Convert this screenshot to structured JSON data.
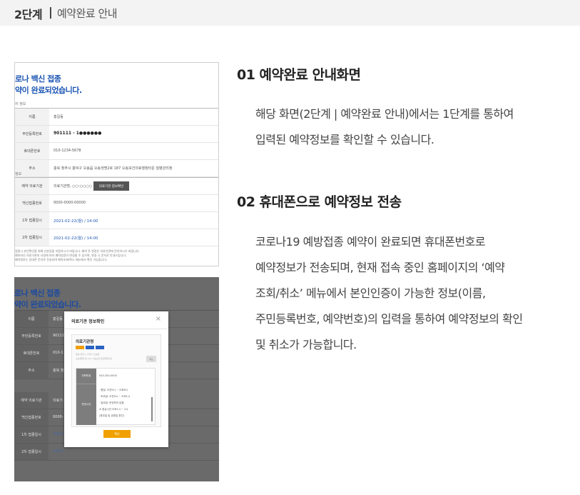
{
  "header": {
    "step": "2단계",
    "separator": "|",
    "title": "예약완료 안내"
  },
  "thumb1": {
    "title_line1": "로나 백신 접종",
    "title_line2": "약이 완료되었습니다.",
    "section1": "자 정보",
    "rows1": [
      {
        "label": "이름",
        "value": "홍길동"
      },
      {
        "label": "주민등록번호",
        "value": "901111 - 1●●●●●●"
      },
      {
        "label": "휴대폰번호",
        "value": "010-1234-5678"
      },
      {
        "label": "주소",
        "value": "충북 청주시 흥덕구 오송읍 오송생명2로 187 오송보건의료행정타운 질병관리청"
      }
    ],
    "section2": "정보",
    "rows2": [
      {
        "label": "예약 의료기관",
        "value": "의료기관명, ○○-○○○○",
        "button": "의료기관 정보확인"
      },
      {
        "label": "백신접종번호",
        "value": "0000-0000-00000"
      },
      {
        "label": "1차 접종일시",
        "value": "2021-02-22(월) / 14:00"
      },
      {
        "label": "2차 접종일시",
        "value": "2021-02-22(월) / 14:00"
      }
    ],
    "notes": [
      "접종시 본인확인을 위해 신분증을 지참하시기 바랍니다. 예약 후 변경은 의료기관에 문의하시기 바랍니다.",
      "예약하신 의료기관의 사정에 따라 예약일정이 변경될 수 있으며, 변경 시 문자로 안내드립니다.",
      "예약정보는 휴대폰 문자로 전송되며 예약조회/취소 메뉴에서 확인 가능합니다."
    ]
  },
  "thumb2": {
    "title_line1": "로나 백신 접종",
    "title_line2": "약이 완료되었습니다.",
    "rows": [
      {
        "label": "이름",
        "value": "홍길동"
      },
      {
        "label": "주민등록번호",
        "value": "90111"
      },
      {
        "label": "휴대폰번호",
        "value": "010-1"
      },
      {
        "label": "주소",
        "value": "충북 청"
      },
      {
        "label": "예약 의료기관",
        "value": "의료기"
      },
      {
        "label": "백신접종번호",
        "value": "0000-"
      },
      {
        "label": "1차 접종일시",
        "value": "2021-"
      },
      {
        "label": "2차 접종일시",
        "value": "2021-"
      }
    ],
    "modal": {
      "title": "의료기관 정보확인",
      "close": "×",
      "hospital": "의료기관명",
      "address_line1": "충북 청주시 흥덕구 오송읍",
      "address_line2": "오송생명2로 187 오송보건의료행정타운",
      "search": "지도",
      "phone_label": "전화번호",
      "phone": "043-200-0000",
      "hours_label": "운영시간",
      "hours": [
        "· 평일: 오전9시 ~ 오후6시",
        "· 토요일: 오전9시 ~ 오후1시",
        "· 일요일: 운영하지 않음",
        "※ 점심시간 오후1시 ~ 2시",
        "(휴무일 및 공휴일 휴진)"
      ],
      "ok": "확인"
    }
  },
  "section1": {
    "heading": "01 예약완료 안내화면",
    "lines": [
      "해당 화면(2단계 | 예약완료 안내)에서는 1단계를 통하여",
      "입력된 예약정보를 확인할 수 있습니다."
    ]
  },
  "section2": {
    "heading": "02 휴대폰으로 예약정보 전송",
    "lines": [
      "코로나19 예방접종 예약이 완료되면 휴대폰번호로",
      "예약정보가 전송되며, 현재 접속 중인 홈페이지의 ‘예약",
      "조회/취소’ 메뉴에서 본인인증이 가능한 정보(이름,",
      "주민등록번호, 예약번호)의 입력을 통하여 예약정보의 확인",
      "및 취소가 가능합니다."
    ]
  },
  "colors": {
    "accent_blue": "#1b55b3",
    "confirm_orange": "#f0a000",
    "header_bg": "#f3f3f3"
  }
}
